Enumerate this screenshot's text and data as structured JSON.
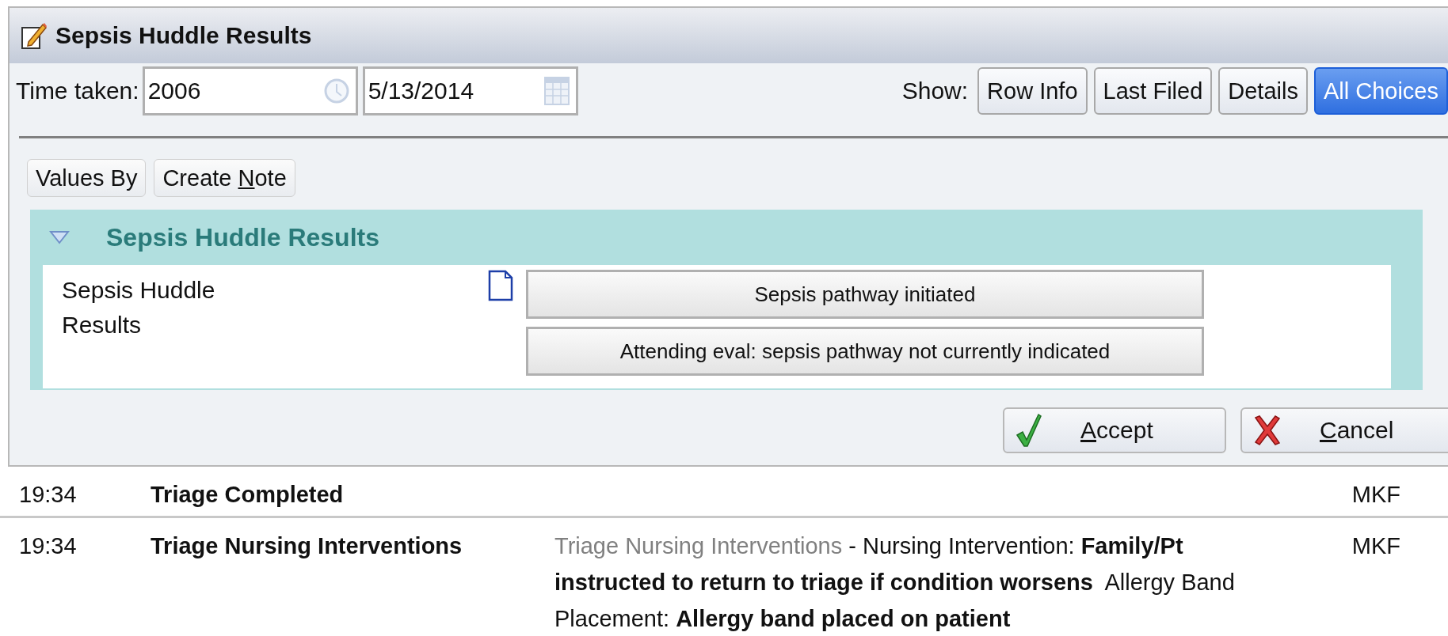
{
  "window": {
    "title": "Sepsis Huddle Results"
  },
  "time_row": {
    "label": "Time taken:",
    "time": "2006",
    "date": "5/13/2014"
  },
  "show": {
    "label": "Show:",
    "options": [
      {
        "label": "Row Info",
        "selected": false
      },
      {
        "label": "Last Filed",
        "selected": false
      },
      {
        "label": "Details",
        "selected": false
      },
      {
        "label": "All Choices",
        "selected": true
      }
    ]
  },
  "toolbar": [
    {
      "label": [
        {
          "text": "Values By",
          "underlined": false
        }
      ]
    },
    {
      "label": [
        {
          "text": "Create ",
          "underlined": false
        },
        {
          "text": "N",
          "underlined": true
        },
        {
          "text": "ote",
          "underlined": false
        }
      ]
    }
  ],
  "section": {
    "title": "Sepsis Huddle Results",
    "expanded": true,
    "row_label": "Sepsis Huddle Results",
    "choices": [
      {
        "label": "Sepsis pathway initiated",
        "selected": false
      },
      {
        "label": "Attending eval: sepsis pathway not currently indicated",
        "selected": false
      }
    ]
  },
  "actions": [
    {
      "kind": "accept",
      "label": [
        {
          "text": "A",
          "underlined": true
        },
        {
          "text": "ccept",
          "underlined": false
        }
      ]
    },
    {
      "kind": "cancel",
      "label": [
        {
          "text": "C",
          "underlined": true
        },
        {
          "text": "ancel",
          "underlined": false
        }
      ]
    }
  ],
  "events": [
    {
      "time": "19:34",
      "title": "Triage Completed",
      "user": "MKF"
    },
    {
      "time": "19:34",
      "title": "Triage Nursing Interventions",
      "details": [
        {
          "kind": "source",
          "text": "Triage Nursing Interventions"
        },
        {
          "kind": "label",
          "text": " - Nursing Intervention: "
        },
        {
          "kind": "value",
          "text": "Family/Pt instructed to return to triage if condition worsens"
        },
        {
          "kind": "label",
          "text": "  Allergy Band Placement: "
        },
        {
          "kind": "value",
          "text": "Allergy band placed on patient"
        }
      ],
      "user": "MKF"
    }
  ]
}
